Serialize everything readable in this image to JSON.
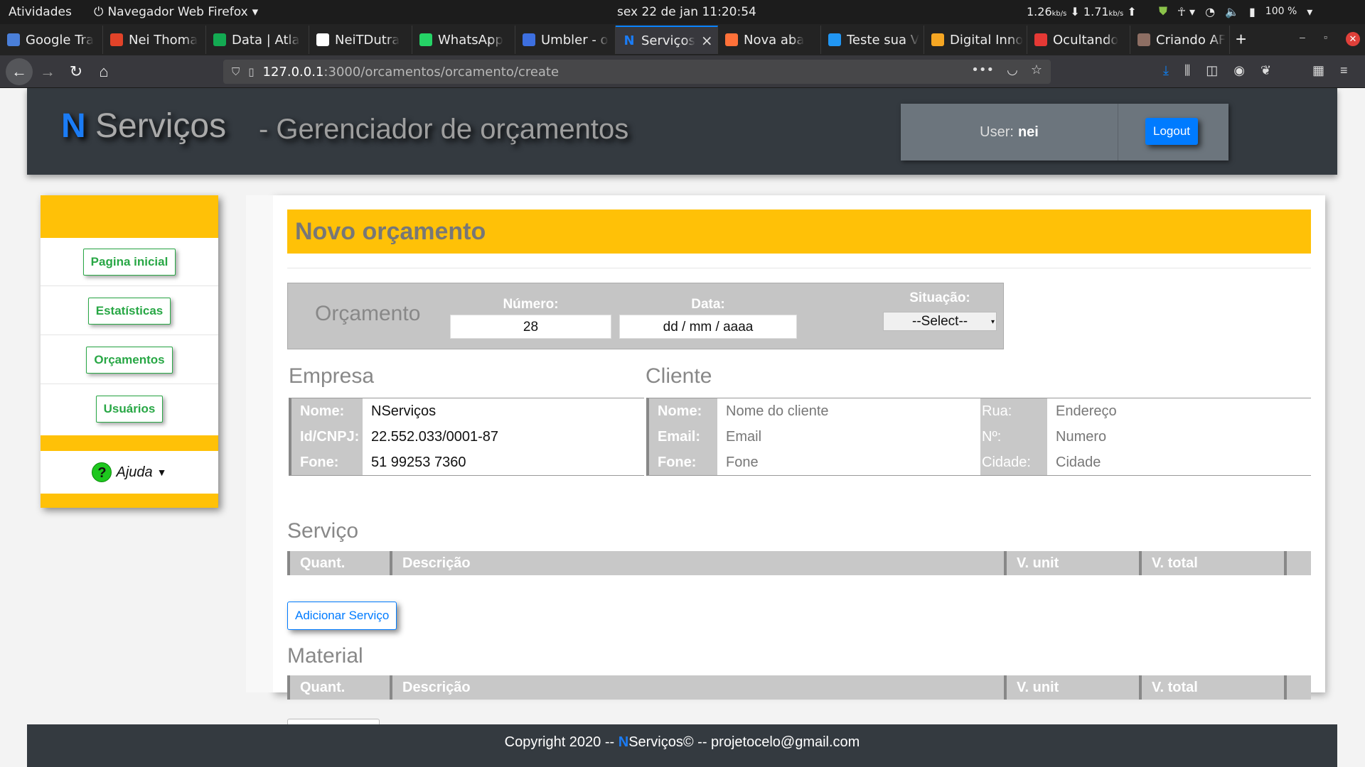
{
  "os_bar": {
    "activities": "Atividades",
    "app_menu": "Navegador Web Firefox",
    "clock": "sex 22 de jan  11:20:54",
    "net_down": "1.26",
    "net_up": "1.71",
    "net_unit": "kb/s",
    "battery": "100 %"
  },
  "tabs": [
    {
      "label": "Google Tra",
      "favicon_color": "#4a7fd9",
      "icon": "google-translate-icon"
    },
    {
      "label": "Nei Thoma",
      "favicon_color": "#e24329",
      "icon": "gitlab-icon"
    },
    {
      "label": "Data | Atla",
      "favicon_color": "#13aa52",
      "icon": "mongodb-leaf-icon"
    },
    {
      "label": "NeiTDutra",
      "favicon_color": "#ffffff",
      "icon": "github-icon"
    },
    {
      "label": "WhatsApp",
      "favicon_color": "#25d366",
      "icon": "whatsapp-icon"
    },
    {
      "label": "Umbler - o",
      "favicon_color": "#3d6fe0",
      "icon": "umbler-icon"
    },
    {
      "label": "Serviços",
      "favicon_color": "#1b7cf5",
      "icon": "n-icon",
      "active": true
    },
    {
      "label": "Nova aba",
      "favicon_color": "#ff7139",
      "icon": "firefox-icon"
    },
    {
      "label": "Teste sua V",
      "favicon_color": "#2196f3",
      "icon": "speedtest-icon"
    },
    {
      "label": "Digital Inno",
      "favicon_color": "#f5a623",
      "icon": "digital-innovation-icon"
    },
    {
      "label": "Ocultando",
      "favicon_color": "#e53935",
      "icon": "qa-icon"
    },
    {
      "label": "Criando AF",
      "favicon_color": "#8d6e63",
      "icon": "article-icon"
    }
  ],
  "browser": {
    "url_host": "127.0.0.1",
    "url_path": ":3000/orcamentos/orcamento/create"
  },
  "header": {
    "brand_n": "N",
    "brand_rest": " Serviços",
    "subtitle": "- Gerenciador de orçamentos",
    "user_label": "User:",
    "user_name": "nei",
    "logout": "Logout"
  },
  "sidebar": {
    "items": [
      "Pagina inicial",
      "Estatísticas",
      "Orçamentos",
      "Usuários"
    ],
    "help": "Ajuda"
  },
  "main": {
    "title": "Novo orçamento",
    "orcamento": {
      "label": "Orçamento",
      "numero_label": "Número:",
      "numero_value": "28",
      "data_label": "Data:",
      "data_placeholder": "dd / mm / aaaa",
      "situacao_label": "Situação:",
      "situacao_value": "--Select--"
    },
    "empresa": {
      "title": "Empresa",
      "rows": [
        {
          "label": "Nome:",
          "value": "NServiços"
        },
        {
          "label": "Id/CNPJ:",
          "value": "22.552.033/0001-87"
        },
        {
          "label": "Fone:",
          "value": "51 99253 7360"
        }
      ]
    },
    "cliente": {
      "title": "Cliente",
      "rows": [
        {
          "label": "Nome:",
          "placeholder": "Nome do cliente",
          "label2": "Rua:",
          "placeholder2": "Endereço"
        },
        {
          "label": "Email:",
          "placeholder": "Email",
          "label2": "Nº:",
          "placeholder2": "Numero"
        },
        {
          "label": "Fone:",
          "placeholder": "Fone",
          "label2": "Cidade:",
          "placeholder2": "Cidade"
        }
      ]
    },
    "servico": {
      "title": "Serviço",
      "columns": [
        "Quant.",
        "Descrição",
        "V. unit",
        "V. total"
      ],
      "add_button": "Adicionar Serviço"
    },
    "material": {
      "title": "Material",
      "columns": [
        "Quant.",
        "Descrição",
        "V. unit",
        "V. total"
      ]
    }
  },
  "footer": {
    "prefix": "Copyright 2020 -- ",
    "n": "N",
    "suffix": "Serviços© -- projetocelo@gmail.com"
  }
}
